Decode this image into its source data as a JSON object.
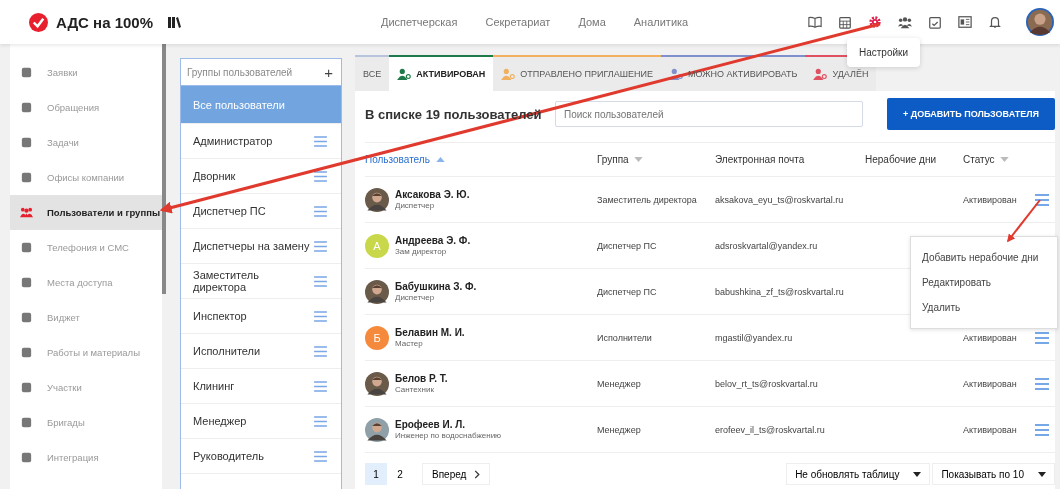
{
  "header": {
    "logo": "АДС на 100%",
    "nav": [
      {
        "label": "Диспетчерская"
      },
      {
        "label": "Секретариат"
      },
      {
        "label": "Дома"
      },
      {
        "label": "Аналитика"
      }
    ],
    "icons": [
      {
        "selected": false
      },
      {
        "selected": false
      },
      {
        "selected": true
      },
      {
        "selected": false
      },
      {
        "selected": false
      },
      {
        "selected": false
      },
      {
        "selected": false
      }
    ],
    "tooltip": "Настройки"
  },
  "sidebar": {
    "items": [
      {
        "label": "Заявки",
        "selected": false
      },
      {
        "label": "Обращения",
        "selected": false
      },
      {
        "label": "Задачи",
        "selected": false
      },
      {
        "label": "Офисы компании",
        "selected": false
      },
      {
        "label": "Пользователи и группы",
        "selected": true
      },
      {
        "label": "Телефония и СМС",
        "selected": false
      },
      {
        "label": "Места доступа",
        "selected": false
      },
      {
        "label": "Виджет",
        "selected": false
      },
      {
        "label": "Работы и материалы",
        "selected": false
      },
      {
        "label": "Участки",
        "selected": false
      },
      {
        "label": "Бригады",
        "selected": false
      },
      {
        "label": "Интеграция",
        "selected": false
      }
    ]
  },
  "groups": {
    "placeholder": "Группы пользователей",
    "add": "+",
    "items": [
      {
        "label": "Все пользователи",
        "selected": true
      },
      {
        "label": "Администратор",
        "selected": false
      },
      {
        "label": "Дворник",
        "selected": false
      },
      {
        "label": "Диспетчер ПС",
        "selected": false
      },
      {
        "label": "Диспетчеры на замену",
        "selected": false
      },
      {
        "label": "Заместитель директора",
        "selected": false
      },
      {
        "label": "Инспектор",
        "selected": false
      },
      {
        "label": "Исполнители",
        "selected": false
      },
      {
        "label": "Клининг",
        "selected": false
      },
      {
        "label": "Менеджер",
        "selected": false
      },
      {
        "label": "Руководитель",
        "selected": false
      }
    ]
  },
  "tabs": [
    {
      "label": "ВСЕ",
      "selected": false,
      "color": "#b8c4dc",
      "kind": "all"
    },
    {
      "label": "АКТИВИРОВАН",
      "selected": true,
      "color": "#1e7a4a",
      "kind": "status"
    },
    {
      "label": "ОТПРАВЛЕНО ПРИГЛАШЕНИЕ",
      "selected": false,
      "color": "#f0b060",
      "kind": "status"
    },
    {
      "label": "МОЖНО АКТИВИРОВАТЬ",
      "selected": false,
      "color": "#8090cc",
      "kind": "status"
    },
    {
      "label": "УДАЛЁН",
      "selected": false,
      "color": "#e05060",
      "kind": "status"
    }
  ],
  "list_count": "В списке 19 пользователей",
  "search": {
    "placeholder": "Поиск пользователей"
  },
  "add_button": "+ ДОБАВИТЬ ПОЛЬЗОВАТЕЛЯ",
  "table": {
    "columns": [
      {
        "label": "Пользователь",
        "sortable": true,
        "sorted": true
      },
      {
        "label": "Группа",
        "sortable": true,
        "sorted": false
      },
      {
        "label": "Электронная почта",
        "sortable": false,
        "sorted": false
      },
      {
        "label": "Нерабочие дни",
        "sortable": false,
        "sorted": false
      },
      {
        "label": "Статус",
        "sortable": true,
        "sorted": false
      }
    ],
    "rows": [
      {
        "name": "Аксакова Э. Ю.",
        "role": "Диспетчер",
        "group": "Заместитель директора",
        "email": "aksakova_eyu_ts@roskvartal.ru",
        "status": "Активирован"
      },
      {
        "name": "Андреева Э. Ф.",
        "role": "Зам директор",
        "kind": "letter",
        "letter": "А",
        "color": "#c8d84a",
        "group": "Диспетчер ПС",
        "email": "adsroskvartal@yandex.ru"
      },
      {
        "name": "Бабушкина З. Ф.",
        "role": "Диспетчер",
        "group": "Диспетчер ПС",
        "email": "babushkina_zf_ts@roskvartal.ru"
      },
      {
        "name": "Белавин М. И.",
        "role": "Мастер",
        "kind": "letter",
        "letter": "Б",
        "color": "#f58a3c",
        "group": "Исполнители",
        "email": "mgastil@yandex.ru",
        "status": "Активирован"
      },
      {
        "name": "Белов Р. Т.",
        "role": "Сантехник",
        "group": "Менеджер",
        "email": "belov_rt_ts@roskvartal.ru",
        "status": "Активирован"
      },
      {
        "name": "Ерофеев И. Л.",
        "role": "Инженер по водоснабжению",
        "group": "Менеджер",
        "email": "erofeev_il_ts@roskvartal.ru",
        "status": "Активирован"
      }
    ]
  },
  "row_menu": {
    "items": [
      {
        "label": "Добавить нерабочие дни"
      },
      {
        "label": "Редактировать"
      },
      {
        "label": "Удалить"
      }
    ]
  },
  "pagination": {
    "pages": [
      {
        "label": "1",
        "selected": true
      },
      {
        "label": "2",
        "selected": false
      }
    ],
    "next": "Вперед",
    "refresh_select": "Не обновлять таблицу",
    "page_size_select": "Показывать по 10"
  }
}
